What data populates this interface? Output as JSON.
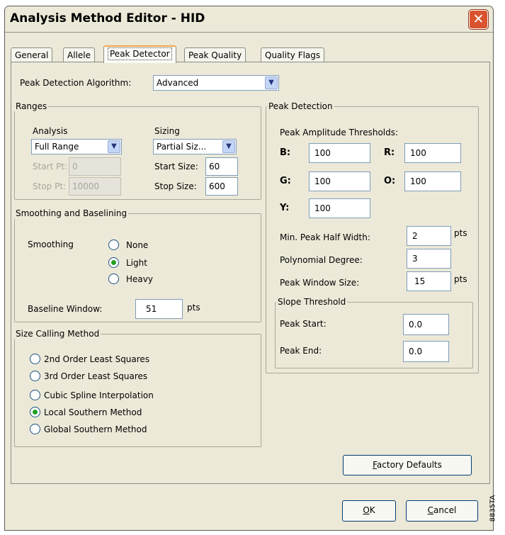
{
  "window": {
    "title": "Analysis Method Editor - HID",
    "close_symbol": "✕"
  },
  "tabs": [
    "General",
    "Allele",
    "Peak Detector",
    "Peak Quality",
    "Quality Flags"
  ],
  "active_tab": "Peak Detector",
  "algorithm": {
    "label": "Peak Detection Algorithm:",
    "value": "Advanced"
  },
  "ranges": {
    "title": "Ranges",
    "analysis_label": "Analysis",
    "analysis_value": "Full Range",
    "start_pt_label": "Start Pt:",
    "start_pt_value": "0",
    "stop_pt_label": "Stop Pt:",
    "stop_pt_value": "10000",
    "sizing_label": "Sizing",
    "sizing_value": "Partial Siz...",
    "start_size_label": "Start Size:",
    "start_size_value": "60",
    "stop_size_label": "Stop Size:",
    "stop_size_value": "600"
  },
  "smoothing": {
    "title": "Smoothing and Baselining",
    "smoothing_label": "Smoothing",
    "options": [
      "None",
      "Light",
      "Heavy"
    ],
    "selected": "Light",
    "baseline_label": "Baseline Window:",
    "baseline_value": "51",
    "baseline_unit": "pts"
  },
  "size_calling": {
    "title": "Size Calling Method",
    "options": [
      "2nd Order Least Squares",
      "3rd Order Least Squares",
      "Cubic Spline Interpolation",
      "Local Southern Method",
      "Global Southern Method"
    ],
    "selected": "Local Southern Method"
  },
  "peak_detection": {
    "title": "Peak Detection",
    "thresholds_label": "Peak Amplitude Thresholds:",
    "B_label": "B:",
    "B_value": "100",
    "R_label": "R:",
    "R_value": "100",
    "G_label": "G:",
    "G_value": "100",
    "O_label": "O:",
    "O_value": "100",
    "Y_label": "Y:",
    "Y_value": "100",
    "min_half_width_label": "Min. Peak Half Width:",
    "min_half_width_value": "2",
    "min_half_width_unit": "pts",
    "poly_degree_label": "Polynomial Degree:",
    "poly_degree_value": "3",
    "window_size_label": "Peak Window Size:",
    "window_size_value": "15",
    "window_size_unit": "pts"
  },
  "slope": {
    "title": "Slope Threshold",
    "start_label": "Peak Start:",
    "start_value": "0.0",
    "end_label": "Peak End:",
    "end_value": "0.0"
  },
  "buttons": {
    "factory_mn": "F",
    "factory_rest": "actory Defaults",
    "ok_mn": "O",
    "ok_rest": "K",
    "cancel_mn": "C",
    "cancel_rest": "ancel"
  },
  "side_label": "8835TA",
  "colors": {
    "frame": "#ece9d8",
    "input_border": "#7f9db9",
    "radio_dot": "#21a121",
    "close": "#d9532e",
    "tab_highlight": "#f1a54a"
  }
}
